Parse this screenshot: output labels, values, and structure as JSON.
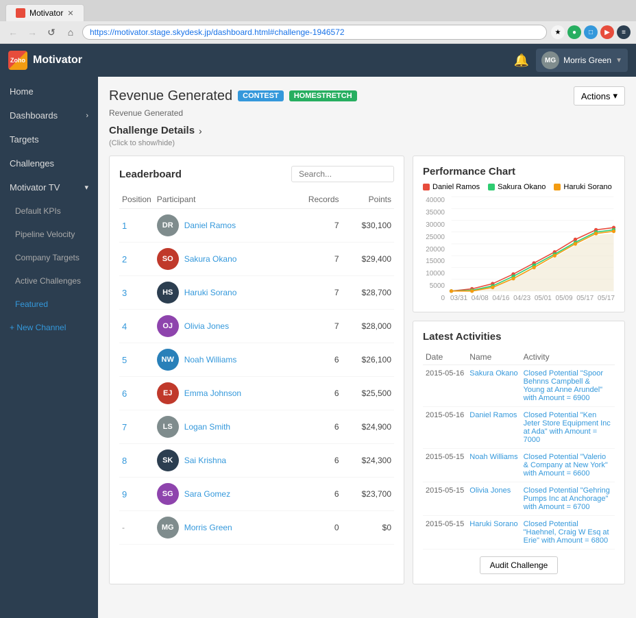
{
  "browser": {
    "tab_title": "Motivator",
    "url": "https://motivator.stage.skydesk.jp/dashboard.html#challenge-1946572",
    "favicon": "M",
    "nav_back": "←",
    "nav_forward": "→",
    "reload": "↺"
  },
  "topnav": {
    "logo": "Zoho",
    "app_title": "Motivator",
    "notif_icon": "🔔",
    "user_name": "Morris Green",
    "user_initials": "MG"
  },
  "sidebar": {
    "items": [
      {
        "label": "Home",
        "level": "top",
        "active": false,
        "has_arrow": false
      },
      {
        "label": "Dashboards",
        "level": "top",
        "active": false,
        "has_arrow": true
      },
      {
        "label": "Targets",
        "level": "top",
        "active": false,
        "has_arrow": false
      },
      {
        "label": "Challenges",
        "level": "top",
        "active": false,
        "has_arrow": false
      },
      {
        "label": "Motivator TV",
        "level": "top",
        "active": false,
        "has_arrow": true
      },
      {
        "label": "Default KPIs",
        "level": "sub",
        "active": false
      },
      {
        "label": "Pipeline Velocity",
        "level": "sub",
        "active": false
      },
      {
        "label": "Company Targets",
        "level": "sub",
        "active": false
      },
      {
        "label": "Active Challenges",
        "level": "sub",
        "active": false
      },
      {
        "label": "Featured",
        "level": "sub",
        "active": true
      }
    ],
    "new_channel": "+ New Channel"
  },
  "page": {
    "title": "Revenue Generated",
    "badge_contest": "CONTEST",
    "badge_homestretch": "HOMESTRETCH",
    "sub_header": "Revenue Generated",
    "actions_btn": "Actions",
    "challenge_details_title": "Challenge Details",
    "click_hint": "(Click to show/hide)"
  },
  "leaderboard": {
    "title": "Leaderboard",
    "search_placeholder": "Search...",
    "columns": [
      "Position",
      "Participant",
      "Records",
      "Points"
    ],
    "rows": [
      {
        "pos": "1",
        "name": "Daniel Ramos",
        "records": "7",
        "points": "$30,100",
        "color": "#7f8c8d",
        "initials": "DR"
      },
      {
        "pos": "2",
        "name": "Sakura Okano",
        "records": "7",
        "points": "$29,400",
        "color": "#c0392b",
        "initials": "SO"
      },
      {
        "pos": "3",
        "name": "Haruki Sorano",
        "records": "7",
        "points": "$28,700",
        "color": "#2c3e50",
        "initials": "HS"
      },
      {
        "pos": "4",
        "name": "Olivia Jones",
        "records": "7",
        "points": "$28,000",
        "color": "#8e44ad",
        "initials": "OJ"
      },
      {
        "pos": "5",
        "name": "Noah Williams",
        "records": "6",
        "points": "$26,100",
        "color": "#2980b9",
        "initials": "NW"
      },
      {
        "pos": "6",
        "name": "Emma Johnson",
        "records": "6",
        "points": "$25,500",
        "color": "#c0392b",
        "initials": "EJ"
      },
      {
        "pos": "7",
        "name": "Logan Smith",
        "records": "6",
        "points": "$24,900",
        "color": "#7f8c8d",
        "initials": "LS"
      },
      {
        "pos": "8",
        "name": "Sai Krishna",
        "records": "6",
        "points": "$24,300",
        "color": "#2c3e50",
        "initials": "SK"
      },
      {
        "pos": "9",
        "name": "Sara Gomez",
        "records": "6",
        "points": "$23,700",
        "color": "#8e44ad",
        "initials": "SG"
      },
      {
        "pos": "-",
        "name": "Morris Green",
        "records": "0",
        "points": "$0",
        "color": "#7f8c8d",
        "initials": "MG"
      }
    ]
  },
  "chart": {
    "title": "Performance Chart",
    "legend": [
      {
        "name": "Daniel Ramos",
        "color": "#e74c3c"
      },
      {
        "name": "Sakura Okano",
        "color": "#2ecc71"
      },
      {
        "name": "Haruki Sorano",
        "color": "#f39c12"
      }
    ],
    "y_labels": [
      "40000",
      "35000",
      "30000",
      "25000",
      "20000",
      "15000",
      "10000",
      "5000",
      "0"
    ],
    "x_labels": [
      "03/31",
      "04/08",
      "04/16",
      "04/23",
      "05/01",
      "05/09",
      "05/17",
      "05/17"
    ]
  },
  "activities": {
    "title": "Latest Activities",
    "columns": [
      "Date",
      "Name",
      "Activity"
    ],
    "rows": [
      {
        "date": "2015-05-16",
        "name": "Sakura Okano",
        "activity": "Closed Potential \"Spoor Behnns Campbell & Young at Anne Arundel\" with Amount = 6900"
      },
      {
        "date": "2015-05-16",
        "name": "Daniel Ramos",
        "activity": "Closed Potential \"Ken Jeter Store Equipment Inc at Ada\" with Amount = 7000"
      },
      {
        "date": "2015-05-15",
        "name": "Noah Williams",
        "activity": "Closed Potential \"Valerio & Company at New York\" with Amount = 6600"
      },
      {
        "date": "2015-05-15",
        "name": "Olivia Jones",
        "activity": "Closed Potential \"Gehring Pumps Inc at Anchorage\" with Amount = 6700"
      },
      {
        "date": "2015-05-15",
        "name": "Haruki Sorano",
        "activity": "Closed Potential \"Haehnel, Craig W Esq at Erie\" with Amount = 6800"
      }
    ],
    "audit_btn": "Audit Challenge"
  }
}
